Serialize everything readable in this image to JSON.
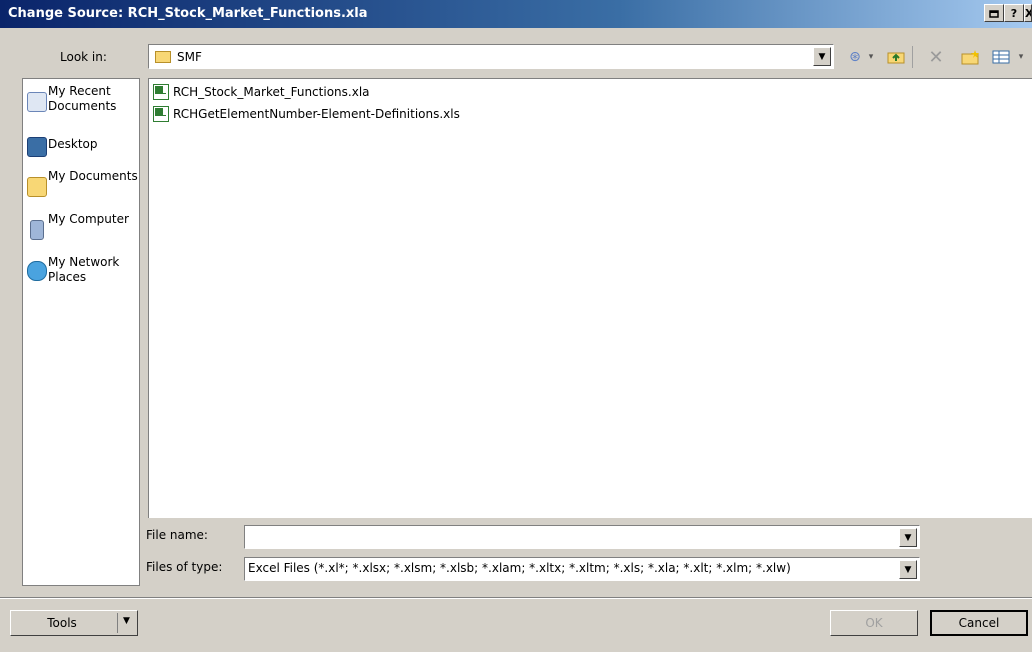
{
  "window": {
    "title": "Change Source: RCH_Stock_Market_Functions.xla",
    "caption_buttons": [
      "?",
      "X"
    ]
  },
  "lookin": {
    "label": "Look in:",
    "value": "SMF"
  },
  "toolbar": {
    "icons": [
      "back-icon",
      "up-folder-icon",
      "delete-icon",
      "new-folder-icon",
      "views-icon"
    ]
  },
  "places": [
    {
      "label": "My Recent Documents",
      "icon": "recent-documents-icon"
    },
    {
      "label": "Desktop",
      "icon": "desktop-icon"
    },
    {
      "label": "My Documents",
      "icon": "my-documents-icon"
    },
    {
      "label": "My Computer",
      "icon": "my-computer-icon"
    },
    {
      "label": "My Network Places",
      "icon": "network-places-icon"
    }
  ],
  "files": [
    {
      "name": "RCH_Stock_Market_Functions.xla",
      "icon": "excel-addin-icon"
    },
    {
      "name": "RCHGetElementNumber-Element-Definitions.xls",
      "icon": "excel-file-icon"
    }
  ],
  "filename": {
    "label": "File name:",
    "value": ""
  },
  "filetype": {
    "label": "Files of type:",
    "value": "Excel Files (*.xl*; *.xlsx; *.xlsm; *.xlsb; *.xlam; *.xltx; *.xltm; *.xls; *.xla; *.xlt; *.xlm; *.xlw)"
  },
  "buttons": {
    "tools": "Tools",
    "ok": "OK",
    "cancel": "Cancel"
  }
}
